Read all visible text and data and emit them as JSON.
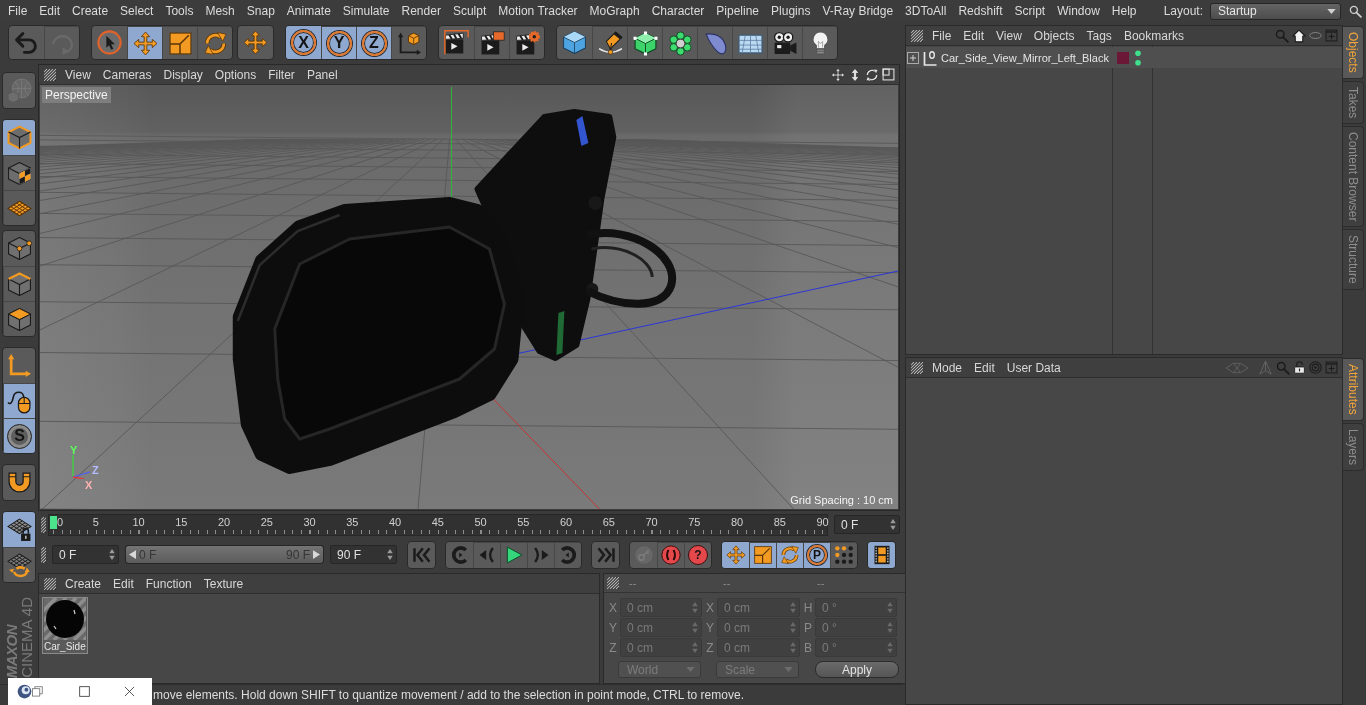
{
  "menu_bar": {
    "items": [
      "File",
      "Edit",
      "Create",
      "Select",
      "Tools",
      "Mesh",
      "Snap",
      "Animate",
      "Simulate",
      "Render",
      "Sculpt",
      "Motion Tracker",
      "MoGraph",
      "Character",
      "Pipeline",
      "Plugins",
      "V-Ray Bridge",
      "3DToAll",
      "Redshift",
      "Script",
      "Window",
      "Help"
    ],
    "layout_label": "Layout:",
    "layout_value": "Startup"
  },
  "toolbar": [
    [
      {
        "kind": "undo",
        "active": false,
        "disabled": false
      },
      {
        "kind": "redo",
        "active": false,
        "disabled": true
      }
    ],
    [
      {
        "kind": "select",
        "active": false
      },
      {
        "kind": "move",
        "active": true
      },
      {
        "kind": "scale",
        "active": false
      },
      {
        "kind": "rotate",
        "active": false
      }
    ],
    [
      {
        "kind": "cross",
        "active": false
      }
    ],
    [
      {
        "kind": "axis",
        "label": "X",
        "active": true
      },
      {
        "kind": "axis",
        "label": "Y",
        "active": true
      },
      {
        "kind": "axis",
        "label": "Z",
        "active": true
      },
      {
        "kind": "coordinates",
        "active": false
      }
    ],
    [
      {
        "kind": "renderview",
        "active": false
      },
      {
        "kind": "picture",
        "active": false
      },
      {
        "kind": "rendersettings",
        "active": false
      }
    ],
    [
      {
        "kind": "cube",
        "active": false
      },
      {
        "kind": "pen",
        "active": false
      },
      {
        "kind": "subdivision",
        "active": false
      },
      {
        "kind": "cloner",
        "active": false
      },
      {
        "kind": "deformer",
        "active": false
      },
      {
        "kind": "floor",
        "active": false
      },
      {
        "kind": "camera",
        "active": false
      },
      {
        "kind": "light",
        "active": false
      }
    ]
  ],
  "side_toolbar": [
    [
      {
        "kind": "editable",
        "active": false,
        "disabled": true
      }
    ],
    [
      {
        "kind": "model",
        "active": true
      },
      {
        "kind": "texture",
        "active": false
      },
      {
        "kind": "workplane",
        "active": false
      }
    ],
    [
      {
        "kind": "points",
        "active": false
      },
      {
        "kind": "edges",
        "active": false
      },
      {
        "kind": "polygons",
        "active": false
      }
    ],
    [
      {
        "kind": "modelaxis",
        "active": false
      },
      {
        "kind": "tweak",
        "active": true
      },
      {
        "kind": "snap",
        "label": "S",
        "active": true
      }
    ],
    [
      {
        "kind": "magnet",
        "active": false
      }
    ],
    [
      {
        "kind": "gridlock",
        "active": true
      },
      {
        "kind": "gridrotate",
        "active": false
      }
    ]
  ],
  "logo": {
    "brand": "MAXON",
    "product": "CINEMA 4D"
  },
  "viewport": {
    "menu": [
      "View",
      "Cameras",
      "Display",
      "Options",
      "Filter",
      "Panel"
    ],
    "camera": "Perspective",
    "grid_spacing": "Grid Spacing : 10 cm",
    "gizmo": [
      {
        "kind": "y",
        "label": "Y"
      },
      {
        "kind": "z",
        "label": "Z"
      },
      {
        "kind": "x",
        "label": "X"
      }
    ]
  },
  "timeline": {
    "ticks": [
      "0",
      "5",
      "10",
      "15",
      "20",
      "25",
      "30",
      "35",
      "40",
      "45",
      "50",
      "55",
      "60",
      "65",
      "70",
      "75",
      "80",
      "85",
      "90"
    ],
    "playhead": {
      "level": 0
    },
    "current_frame": "0 F"
  },
  "playback": {
    "start": "0 F",
    "range": {
      "start": "0 F",
      "end": "90 F",
      "level": 1
    },
    "end": "90 F",
    "groups": [
      [
        {
          "kind": "first",
          "active": false
        }
      ],
      [
        {
          "kind": "prevkey",
          "active": false
        },
        {
          "kind": "prevframe",
          "active": false
        },
        {
          "kind": "play",
          "active": false
        },
        {
          "kind": "nextframe",
          "active": false
        },
        {
          "kind": "nextkey",
          "active": false
        }
      ],
      [
        {
          "kind": "last",
          "active": false
        }
      ],
      [
        {
          "kind": "key",
          "active": false,
          "disabled": true
        },
        {
          "kind": "record",
          "active": false,
          "disabled": false
        },
        {
          "kind": "autokey",
          "label": "?",
          "active": false,
          "disabled": false
        }
      ],
      [
        {
          "kind": "move",
          "active": true
        },
        {
          "kind": "scale",
          "active": true
        },
        {
          "kind": "rotate",
          "active": true
        },
        {
          "kind": "param",
          "label": "P",
          "active": true
        },
        {
          "kind": "pla",
          "active": false
        }
      ],
      [
        {
          "kind": "film",
          "active": true
        }
      ]
    ]
  },
  "materials": {
    "menu": [
      "Create",
      "Edit",
      "Function",
      "Texture"
    ],
    "items": [
      {
        "name": "Car_Side"
      }
    ]
  },
  "coordinates": {
    "headers": [
      "--",
      "--",
      "--"
    ],
    "disabled": true,
    "rows": [
      [
        {
          "label": "X",
          "value": "0 cm"
        },
        {
          "label": "X",
          "value": "0 cm"
        },
        {
          "label": "H",
          "value": "0 °"
        }
      ],
      [
        {
          "label": "Y",
          "value": "0 cm"
        },
        {
          "label": "Y",
          "value": "0 cm"
        },
        {
          "label": "P",
          "value": "0 °"
        }
      ],
      [
        {
          "label": "Z",
          "value": "0 cm"
        },
        {
          "label": "Z",
          "value": "0 cm"
        },
        {
          "label": "B",
          "value": "0 °"
        }
      ]
    ],
    "dropdowns": [
      "World",
      "Scale"
    ],
    "apply": "Apply"
  },
  "status_bar": {
    "text": "move elements. Hold down SHIFT to quantize movement / add to the selection in point mode, CTRL to remove."
  },
  "objects_manager": {
    "menu": [
      "File",
      "Edit",
      "View",
      "Objects",
      "Tags",
      "Bookmarks"
    ],
    "objects": [
      {
        "name": "Car_Side_View_Mirror_Left_Black",
        "expanded": false,
        "color": "#6b1836"
      }
    ],
    "tabs": [
      {
        "label": "Objects",
        "selected": true
      },
      {
        "label": "Takes",
        "selected": false
      },
      {
        "label": "Content Browser",
        "selected": false
      },
      {
        "label": "Structure",
        "selected": false
      }
    ]
  },
  "attributes_manager": {
    "menu": [
      "Mode",
      "Edit",
      "User Data"
    ],
    "tabs": [
      {
        "label": "Attributes",
        "selected": true
      },
      {
        "label": "Layers",
        "selected": false
      }
    ]
  }
}
